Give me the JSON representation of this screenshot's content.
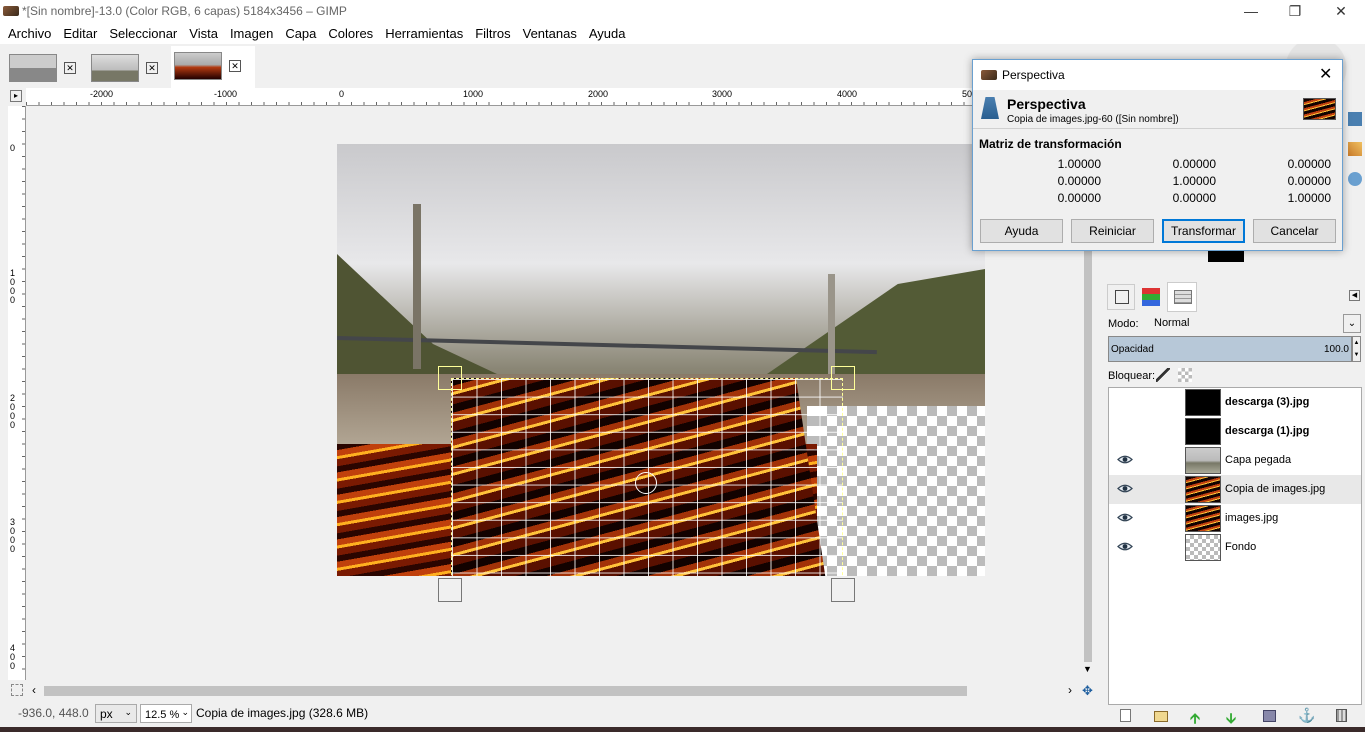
{
  "window": {
    "title": "*[Sin nombre]-13.0 (Color RGB, 6 capas) 5184x3456 – GIMP"
  },
  "menu": [
    "Archivo",
    "Editar",
    "Seleccionar",
    "Vista",
    "Imagen",
    "Capa",
    "Colores",
    "Herramientas",
    "Filtros",
    "Ventanas",
    "Ayuda"
  ],
  "ruler_top": [
    "-2000",
    "-1000",
    "0",
    "1000",
    "2000",
    "3000",
    "4000",
    "50"
  ],
  "ruler_left": [
    "0",
    "1\n0\n0\n0",
    "2\n0\n0\n0",
    "3\n0\n0\n0",
    "4\n0\n0"
  ],
  "status": {
    "coords": "-936.0, 448.0",
    "unit": "px",
    "zoom": "12.5 %",
    "info": "Copia de images.jpg (328.6 MB)"
  },
  "dialog": {
    "window_title": "Perspectiva",
    "heading": "Perspectiva",
    "subtitle": "Copia de images.jpg-60 ([Sin nombre])",
    "matrix_label": "Matriz de transformación",
    "matrix": [
      [
        "1.00000",
        "0.00000",
        "0.00000"
      ],
      [
        "0.00000",
        "1.00000",
        "0.00000"
      ],
      [
        "0.00000",
        "0.00000",
        "1.00000"
      ]
    ],
    "buttons": {
      "help": "Ayuda",
      "reset": "Reiniciar",
      "transform": "Transformar",
      "cancel": "Cancelar"
    }
  },
  "layers_panel": {
    "mode_label": "Modo:",
    "mode_value": "Normal",
    "opacity_label": "Opacidad",
    "opacity_value": "100.0",
    "lock_label": "Bloquear:",
    "layers": [
      {
        "name": "descarga (3).jpg",
        "visible": false,
        "bold": true,
        "thumb": "black"
      },
      {
        "name": "descarga (1).jpg",
        "visible": false,
        "bold": true,
        "thumb": "black"
      },
      {
        "name": "Capa pegada",
        "visible": true,
        "bold": false,
        "thumb": "sky"
      },
      {
        "name": "Copia de images.jpg",
        "visible": true,
        "bold": false,
        "thumb": "lava-checker",
        "selected": true
      },
      {
        "name": "images.jpg",
        "visible": true,
        "bold": false,
        "thumb": "lava-checker"
      },
      {
        "name": "Fondo",
        "visible": true,
        "bold": false,
        "thumb": "checker"
      }
    ]
  },
  "colors": {
    "accent": "#0078d7",
    "selection_row": "#e8e8e8",
    "opacity_bar": "#b7c8d8"
  }
}
